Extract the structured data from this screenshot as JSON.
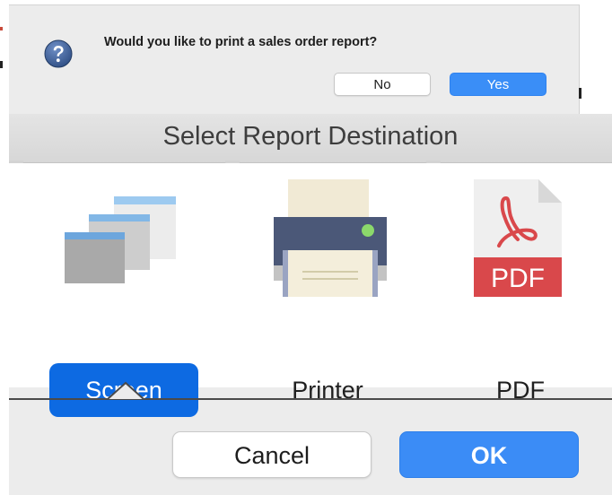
{
  "alert": {
    "message": "Would you like to print a sales order report?",
    "icon": "question-icon",
    "no_label": "No",
    "yes_label": "Yes"
  },
  "sheet": {
    "title": "Select Report Destination",
    "destinations": [
      {
        "label": "Screen",
        "icon": "screen-windows-icon",
        "selected": true
      },
      {
        "label": "Printer",
        "icon": "printer-icon",
        "selected": false
      },
      {
        "label": "PDF",
        "icon": "pdf-file-icon",
        "selected": false
      }
    ],
    "pdf_badge": "PDF",
    "cancel_label": "Cancel",
    "ok_label": "OK"
  },
  "colors": {
    "accent": "#0d6ae2",
    "primary_button": "#3b8cf6",
    "pdf_red": "#d9484b",
    "printer_slate": "#4b5878",
    "printer_led": "#8bd86b",
    "help_icon": "#3c5e95"
  }
}
